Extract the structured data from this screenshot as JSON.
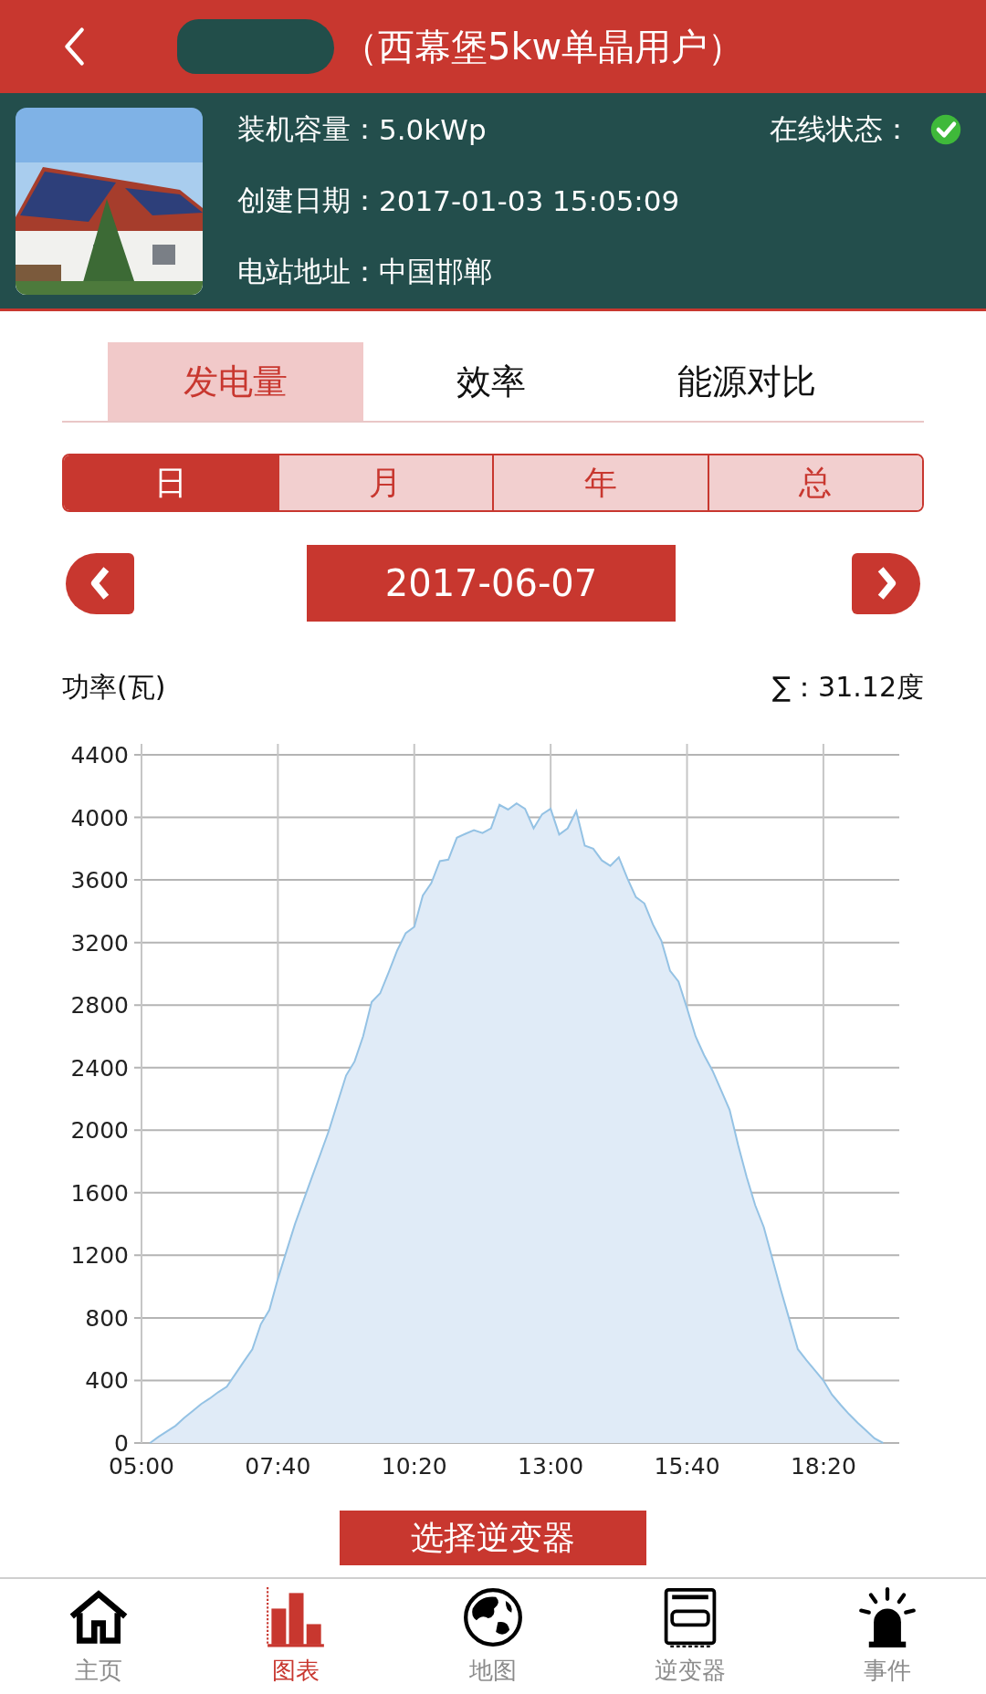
{
  "header": {
    "title": "（西幕堡5kw单晶用户）"
  },
  "station": {
    "fields": [
      {
        "label": "装机容量：",
        "value": "5.0kWp"
      },
      {
        "label": "创建日期：",
        "value": "2017-01-03 15:05:09"
      },
      {
        "label": "电站地址：",
        "value": "中国邯郸"
      }
    ],
    "status": {
      "label": "在线状态：",
      "online": true
    }
  },
  "tabs": [
    {
      "label": "发电量",
      "selected": true
    },
    {
      "label": "效率",
      "selected": false
    },
    {
      "label": "能源对比",
      "selected": false
    }
  ],
  "periods": [
    {
      "label": "日",
      "selected": true
    },
    {
      "label": "月",
      "selected": false
    },
    {
      "label": "年",
      "selected": false
    },
    {
      "label": "总",
      "selected": false
    }
  ],
  "date": "2017-06-07",
  "chart": {
    "total": "∑：31.12度",
    "chart_data": {
      "type": "area",
      "ylabel": "功率(瓦)",
      "categories": [
        "05:00",
        null,
        null,
        null,
        null,
        null,
        null,
        null,
        null,
        null,
        null,
        null,
        null,
        null,
        null,
        null,
        "07:40",
        null,
        null,
        null,
        null,
        null,
        null,
        null,
        null,
        null,
        null,
        null,
        null,
        null,
        null,
        null,
        "10:20",
        null,
        null,
        null,
        null,
        null,
        null,
        null,
        null,
        null,
        null,
        null,
        null,
        null,
        null,
        null,
        "13:00",
        null,
        null,
        null,
        null,
        null,
        null,
        null,
        null,
        null,
        null,
        null,
        null,
        null,
        null,
        null,
        "15:40",
        null,
        null,
        null,
        null,
        null,
        null,
        null,
        null,
        null,
        null,
        null,
        null,
        null,
        null,
        null,
        "18:20",
        null,
        null,
        null,
        null,
        null,
        null,
        null,
        null
      ],
      "values": [
        null,
        0,
        40,
        75,
        110,
        160,
        205,
        250,
        285,
        325,
        360,
        440,
        520,
        600,
        760,
        850,
        1050,
        1225,
        1400,
        1550,
        1700,
        1850,
        2000,
        2175,
        2350,
        2440,
        2600,
        2820,
        2875,
        3010,
        3150,
        3260,
        3300,
        3500,
        3580,
        3720,
        3730,
        3870,
        3895,
        3918,
        3900,
        3930,
        4080,
        4050,
        4090,
        4055,
        3930,
        4020,
        4055,
        3890,
        3930,
        4040,
        3820,
        3800,
        3725,
        3690,
        3745,
        3610,
        3490,
        3450,
        3315,
        3210,
        3020,
        2950,
        2780,
        2600,
        2480,
        2380,
        2255,
        2130,
        1905,
        1700,
        1520,
        1380,
        1180,
        980,
        790,
        600,
        530,
        465,
        400,
        310,
        245,
        185,
        130,
        80,
        30,
        0,
        null
      ],
      "ylim": [
        0,
        4400
      ],
      "grid": true,
      "yticks": [
        0,
        400,
        800,
        1200,
        1600,
        2000,
        2400,
        2800,
        3200,
        3600,
        4000,
        4400
      ]
    }
  },
  "select_button": "选择逆变器",
  "nav": [
    {
      "label": "主页",
      "kind": "home",
      "selected": false
    },
    {
      "label": "图表",
      "kind": "chart",
      "selected": true
    },
    {
      "label": "地图",
      "kind": "map",
      "selected": false
    },
    {
      "label": "逆变器",
      "kind": "inverter",
      "selected": false
    },
    {
      "label": "事件",
      "kind": "event",
      "selected": false
    }
  ]
}
